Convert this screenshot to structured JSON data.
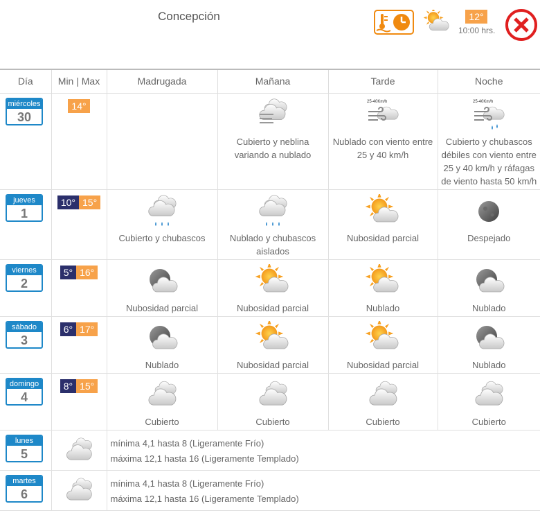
{
  "header": {
    "city": "Concepción",
    "current_temp": "12°",
    "time": "10:00 hrs.",
    "icons": {
      "clock": "thermometer-clock-icon",
      "weather": "sun-cloud-icon",
      "close": "close-icon"
    }
  },
  "table": {
    "headers": [
      "Día",
      "Min | Max",
      "Madrugada",
      "Mañana",
      "Tarde",
      "Noche"
    ]
  },
  "days": [
    {
      "name": "miércoles",
      "num": "30",
      "min": "",
      "max": "14°",
      "periods": [
        {
          "icon": "",
          "desc": ""
        },
        {
          "icon": "fog-cloud-icon",
          "desc": "Cubierto y neblina variando a nublado"
        },
        {
          "icon": "wind-cloud-icon",
          "wind": "25-40Km/h",
          "desc": "Nublado con viento entre 25 y 40 km/h"
        },
        {
          "icon": "wind-rain-cloud-icon",
          "wind": "25-40Km/h",
          "desc": "Cubierto y chubascos débiles con viento entre 25 y 40 km/h y ráfagas de viento hasta 50 km/h"
        }
      ]
    },
    {
      "name": "jueves",
      "num": "1",
      "min": "10°",
      "max": "15°",
      "periods": [
        {
          "icon": "rain-cloud-icon",
          "desc": "Cubierto y chubascos"
        },
        {
          "icon": "rain-cloud-icon",
          "desc": "Nublado y chubascos aislados"
        },
        {
          "icon": "sun-cloud-icon",
          "desc": "Nubosidad parcial"
        },
        {
          "icon": "moon-icon",
          "desc": "Despejado"
        }
      ]
    },
    {
      "name": "viernes",
      "num": "2",
      "min": "5°",
      "max": "16°",
      "periods": [
        {
          "icon": "moon-cloud-icon",
          "desc": "Nubosidad parcial"
        },
        {
          "icon": "sun-cloud-icon",
          "desc": "Nubosidad parcial"
        },
        {
          "icon": "sun-cloud-icon",
          "desc": "Nublado"
        },
        {
          "icon": "moon-cloud-icon",
          "desc": "Nublado"
        }
      ]
    },
    {
      "name": "sábado",
      "num": "3",
      "min": "6°",
      "max": "17°",
      "periods": [
        {
          "icon": "moon-cloud-icon",
          "desc": "Nublado"
        },
        {
          "icon": "sun-cloud-icon",
          "desc": "Nubosidad parcial"
        },
        {
          "icon": "sun-cloud-icon",
          "desc": "Nubosidad parcial"
        },
        {
          "icon": "moon-cloud-icon",
          "desc": "Nublado"
        }
      ]
    },
    {
      "name": "domingo",
      "num": "4",
      "min": "8°",
      "max": "15°",
      "periods": [
        {
          "icon": "cloud-icon",
          "desc": "Cubierto"
        },
        {
          "icon": "cloud-icon",
          "desc": "Cubierto"
        },
        {
          "icon": "cloud-icon",
          "desc": "Cubierto"
        },
        {
          "icon": "cloud-icon",
          "desc": "Cubierto"
        }
      ]
    }
  ],
  "extended": [
    {
      "name": "lunes",
      "num": "5",
      "icon": "cloud-icon",
      "min_text": "mínima 4,1 hasta 8 (Ligeramente Frío)",
      "max_text": "máxima 12,1 hasta 16 (Ligeramente Templado)"
    },
    {
      "name": "martes",
      "num": "6",
      "icon": "cloud-icon",
      "min_text": "mínima 4,1 hasta 8 (Ligeramente Frío)",
      "max_text": "máxima 12,1 hasta 16 (Ligeramente Templado)"
    }
  ],
  "colors": {
    "accent_blue": "#1e88c8",
    "max_orange": "#f7a24a",
    "min_navy": "#2b2f6b",
    "close_red": "#e02020"
  }
}
